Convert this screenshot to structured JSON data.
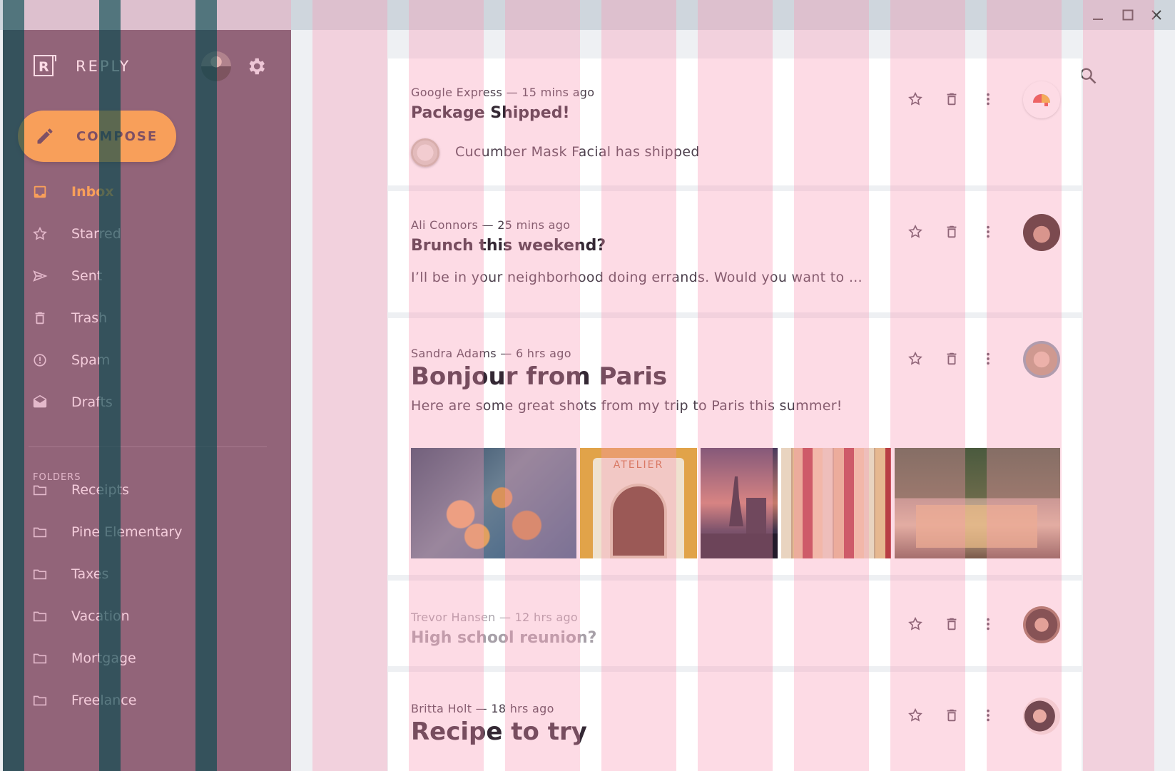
{
  "window": {
    "controls": [
      "minimize-icon",
      "maximize-icon",
      "close-icon"
    ]
  },
  "sidebar": {
    "brand": "REPLY",
    "compose_label": "COMPOSE",
    "nav": [
      {
        "label": "Inbox",
        "icon": "inbox-icon",
        "active": true
      },
      {
        "label": "Starred",
        "icon": "star-icon",
        "active": false
      },
      {
        "label": "Sent",
        "icon": "send-icon",
        "active": false
      },
      {
        "label": "Trash",
        "icon": "trash-icon",
        "active": false
      },
      {
        "label": "Spam",
        "icon": "spam-icon",
        "active": false
      },
      {
        "label": "Drafts",
        "icon": "drafts-icon",
        "active": false
      }
    ],
    "folders_title": "FOLDERS",
    "folders": [
      {
        "label": "Receipts"
      },
      {
        "label": "Pine Elementary"
      },
      {
        "label": "Taxes"
      },
      {
        "label": "Vacation"
      },
      {
        "label": "Mortgage"
      },
      {
        "label": "Freelance"
      }
    ]
  },
  "emails": [
    {
      "meta": "Google Express — 15 mins ago",
      "subject": "Package Shipped!",
      "preview": "Cucumber Mask Facial has shipped"
    },
    {
      "meta": "Ali Connors — 25 mins ago",
      "subject": "Brunch this weekend?",
      "preview": "I’ll be in your neighborhood doing errands. Would you want to …"
    },
    {
      "meta": "Sandra Adams — 6 hrs ago",
      "subject": "Bonjour from Paris",
      "preview": "Here are some great shots from my trip to Paris this summer!"
    },
    {
      "meta": "Trevor Hansen — 12 hrs ago",
      "subject": "High school reunion?"
    },
    {
      "meta": "Britta Holt — 18 hrs ago",
      "subject": "Recipe to try"
    }
  ],
  "photo_sign": "ATELIER",
  "colors": {
    "sidebar": "#5d4b5c",
    "accent": "#f8a52c",
    "grid_pink": "#f896b2",
    "grid_teal": "#28545c"
  }
}
